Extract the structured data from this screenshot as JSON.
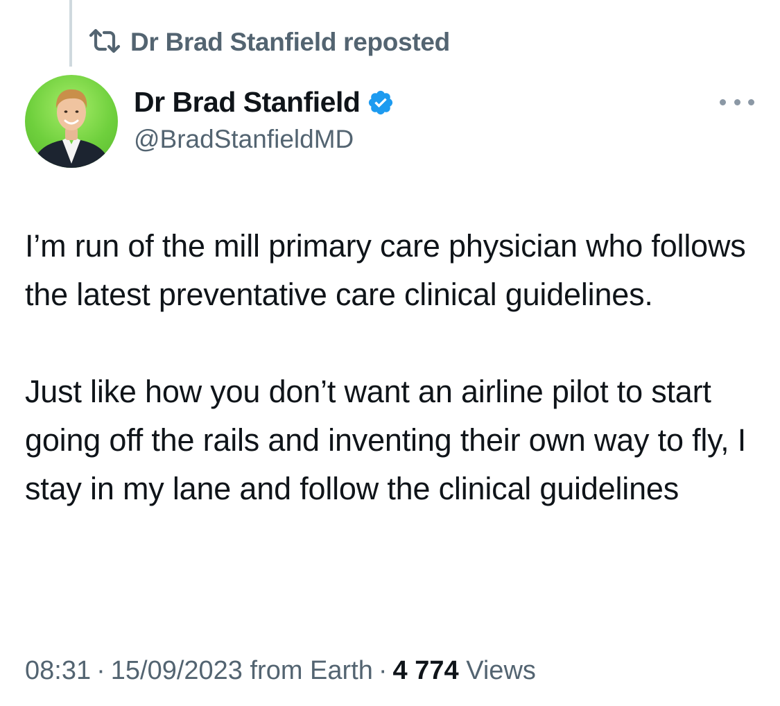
{
  "repost": {
    "label": "Dr Brad Stanfield reposted",
    "icon": "repost-icon"
  },
  "author": {
    "display_name": "Dr Brad Stanfield",
    "handle": "@BradStanfieldMD",
    "verified_icon": "verified-badge-icon",
    "verified_color": "#1d9bf0",
    "avatar_bg": "#6fd03d"
  },
  "tweet": {
    "paragraphs": [
      "I’m run of the mill primary care physician who follows the latest preventative care clinical guidelines.",
      "Just like how you don’t want an airline pilot to start going off the rails and inventing their own way to fly, I stay in my lane and follow the clinical guidelines"
    ]
  },
  "meta": {
    "time": "08:31",
    "date": "15/09/2023",
    "source": "from Earth",
    "separator": "·",
    "views_count": "4 774",
    "views_label": "Views"
  },
  "colors": {
    "text_primary": "#0f1419",
    "text_secondary": "#536471",
    "thread_line": "#cfd9de"
  }
}
